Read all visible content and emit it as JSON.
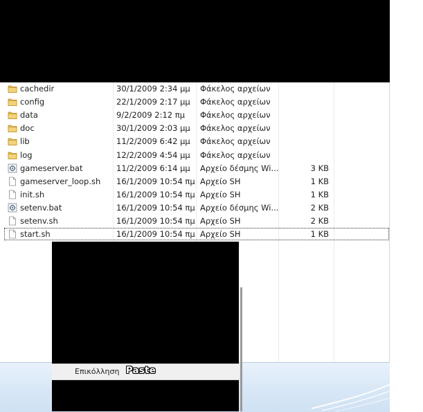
{
  "files": [
    {
      "name": "cachedir",
      "date": "30/1/2009 2:34 μμ",
      "type": "Φάκελος αρχείων",
      "size": "",
      "icon": "folder-icon"
    },
    {
      "name": "config",
      "date": "22/1/2009 2:17 μμ",
      "type": "Φάκελος αρχείων",
      "size": "",
      "icon": "folder-icon"
    },
    {
      "name": "data",
      "date": "9/2/2009 2:12 πμ",
      "type": "Φάκελος αρχείων",
      "size": "",
      "icon": "folder-icon"
    },
    {
      "name": "doc",
      "date": "30/1/2009 2:03 μμ",
      "type": "Φάκελος αρχείων",
      "size": "",
      "icon": "folder-icon"
    },
    {
      "name": "lib",
      "date": "11/2/2009 6:42 μμ",
      "type": "Φάκελος αρχείων",
      "size": "",
      "icon": "folder-icon"
    },
    {
      "name": "log",
      "date": "12/2/2009 4:54 μμ",
      "type": "Φάκελος αρχείων",
      "size": "",
      "icon": "folder-icon"
    },
    {
      "name": "gameserver.bat",
      "date": "11/2/2009 6:14 μμ",
      "type": "Αρχείο δέσμης Wi...",
      "size": "3 KB",
      "icon": "batch-file-icon"
    },
    {
      "name": "gameserver_loop.sh",
      "date": "16/1/2009 10:54 πμ",
      "type": "Αρχείο SH",
      "size": "1 KB",
      "icon": "document-icon"
    },
    {
      "name": "init.sh",
      "date": "16/1/2009 10:54 πμ",
      "type": "Αρχείο SH",
      "size": "1 KB",
      "icon": "document-icon"
    },
    {
      "name": "setenv.bat",
      "date": "16/1/2009 10:54 πμ",
      "type": "Αρχείο δέσμης Wi...",
      "size": "2 KB",
      "icon": "batch-file-icon"
    },
    {
      "name": "setenv.sh",
      "date": "16/1/2009 10:54 πμ",
      "type": "Αρχείο SH",
      "size": "2 KB",
      "icon": "document-icon"
    },
    {
      "name": "start.sh",
      "date": "16/1/2009 10:54 πμ",
      "type": "Αρχείο SH",
      "size": "1 KB",
      "icon": "document-icon"
    }
  ],
  "selected_file": "start.sh",
  "context_menu": {
    "paste_label": "Επικόλληση",
    "paste_label_en": "Paste"
  },
  "colors": {
    "folder": "#e8c15a",
    "status_bar": "#d8e7f6",
    "menu_item_bg": "#f0f0f0"
  }
}
